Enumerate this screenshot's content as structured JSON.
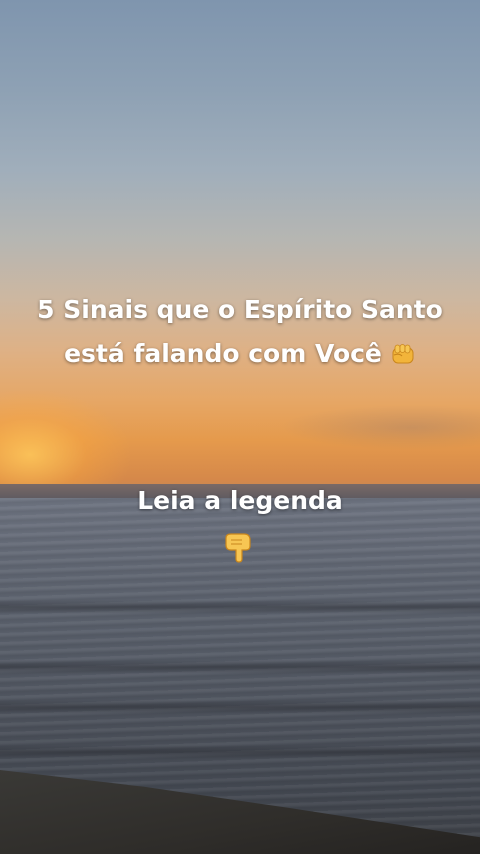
{
  "caption": {
    "line1": "5 Sinais que o Espírito Santo",
    "line2": "está falando com Você",
    "line2_icon": "raised-fist-icon",
    "footer": "Leia a legenda",
    "footer_icon": "pointing-down-hand-icon"
  },
  "colors": {
    "text": "#ffffff",
    "sky_top": "#7f95ae",
    "sunset": "#e59a4c",
    "sea": "#555b66"
  }
}
